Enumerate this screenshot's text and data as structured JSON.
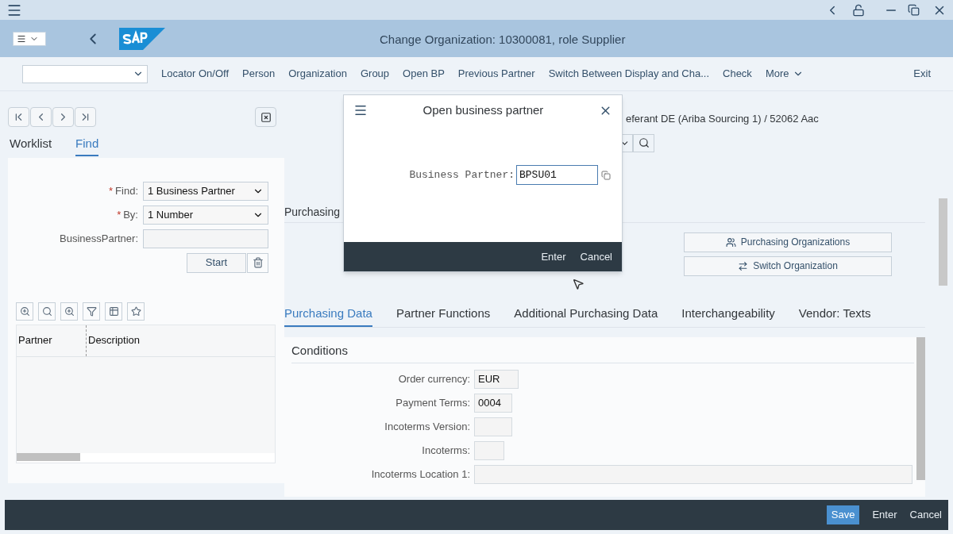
{
  "window": {
    "title": "Change Organization: 10300081, role Supplier"
  },
  "toolbar": {
    "items": [
      "Locator On/Off",
      "Person",
      "Organization",
      "Group",
      "Open BP",
      "Previous Partner",
      "Switch Between Display and Cha...",
      "Check"
    ],
    "more": "More",
    "exit": "Exit"
  },
  "locator": {
    "tabs": [
      {
        "label": "Worklist",
        "selected": false
      },
      {
        "label": "Find",
        "selected": true
      }
    ],
    "find_form": [
      {
        "label": "Find:",
        "marker": "*",
        "kind": "dropdown",
        "value": "1 Business Partner"
      },
      {
        "label": "By:",
        "marker": "*",
        "kind": "dropdown",
        "value": "1 Number"
      },
      {
        "label": "BusinessPartner:",
        "kind": "input"
      }
    ],
    "start_button": "Start",
    "table": {
      "columns": [
        "Partner",
        "Description"
      ]
    }
  },
  "partner_header": "eferant DE (Ariba Sourcing 1) / 52062 Aac",
  "section_title": "Purchasing",
  "side_buttons": [
    "Purchasing Organizations",
    "Switch Organization"
  ],
  "detail_tabs": [
    {
      "label": "Purchasing Data",
      "selected": true
    },
    {
      "label": "Partner Functions",
      "selected": false
    },
    {
      "label": "Additional Purchasing Data",
      "selected": false
    },
    {
      "label": "Interchangeability",
      "selected": false
    },
    {
      "label": "Vendor: Texts",
      "selected": false
    }
  ],
  "conditions": {
    "title": "Conditions",
    "fields": [
      {
        "label": "Order currency:",
        "value": "EUR"
      },
      {
        "label": "Payment Terms:",
        "value": "0004"
      },
      {
        "label": "Incoterms Version:"
      },
      {
        "label": "Incoterms:"
      },
      {
        "label": "Incoterms Location 1:"
      }
    ]
  },
  "dialog": {
    "title": "Open business partner",
    "field_label": "Business Partner:",
    "field_value": "BPSU01",
    "buttons": [
      "Enter",
      "Cancel"
    ]
  },
  "footer": {
    "buttons": [
      {
        "label": "Save",
        "primary": true
      },
      {
        "label": "Enter",
        "primary": false
      },
      {
        "label": "Cancel",
        "primary": false
      }
    ]
  }
}
